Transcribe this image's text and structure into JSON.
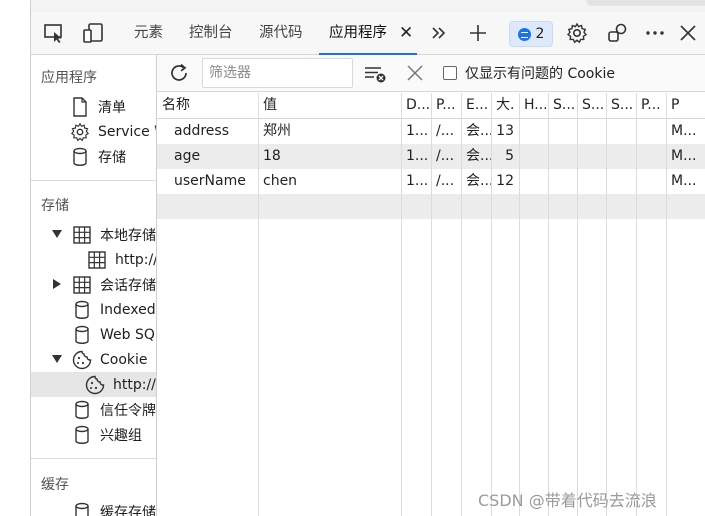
{
  "toolbar": {
    "tabs": [
      "元素",
      "控制台",
      "源代码",
      "应用程序"
    ],
    "active_tab": "应用程序",
    "issues_count": "2"
  },
  "sidebar": {
    "sections": {
      "application": "应用程序",
      "storage": "存储",
      "cache": "缓存"
    },
    "app_items": [
      "清单",
      "Service W",
      "存储"
    ],
    "storage_items": [
      "本地存储",
      "http://",
      "会话存储",
      "IndexedD",
      "Web SQL",
      "Cookie",
      "http://",
      "信任令牌",
      "兴趣组"
    ],
    "cache_items": [
      "缓存存储"
    ]
  },
  "cookies": {
    "filter_placeholder": "筛选器",
    "only_issues_label": "仅显示有问题的 Cookie",
    "columns": [
      "名称",
      "值",
      "D...",
      "P...",
      "E...",
      "大.",
      "H...",
      "S...",
      "S...",
      "S...",
      "P...",
      "P"
    ],
    "rows": [
      [
        "address",
        "郑州",
        "1...",
        "/...",
        "会...",
        "13",
        "",
        "",
        "",
        "",
        "",
        "M..."
      ],
      [
        "age",
        "18",
        "1...",
        "/...",
        "会...",
        "5",
        "",
        "",
        "",
        "",
        "",
        "M..."
      ],
      [
        "userName",
        "chen",
        "1...",
        "/...",
        "会...",
        "12",
        "",
        "",
        "",
        "",
        "",
        "M..."
      ]
    ]
  },
  "watermark": "CSDN @带着代码去流浪",
  "colors": {
    "accent": "#1a73e8",
    "selected_row": "#ececec",
    "badge_bg": "#dde9fb"
  }
}
